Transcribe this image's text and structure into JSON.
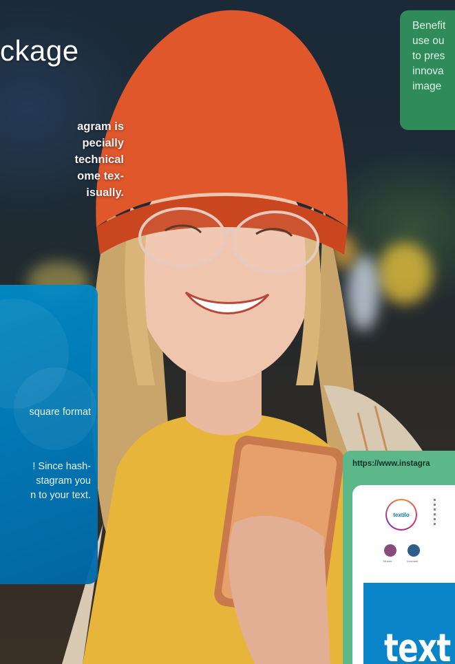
{
  "page": {
    "title": "ckage",
    "intro_lines": [
      "agram is",
      "pecially",
      "technical",
      "ome tex-",
      "isually."
    ]
  },
  "blue_card": {
    "text_1": "square format",
    "text_2_lines": [
      "! Since hash-",
      "stagram you",
      "n to your text."
    ]
  },
  "green_card": {
    "lines": [
      "Benefit",
      "use ou",
      "to pres",
      "innova",
      "image"
    ]
  },
  "instagram_preview": {
    "url": "https://www.instagra",
    "avatar_text": "textilo",
    "highlights": [
      "Muster",
      "Vorrmant"
    ],
    "post_text": "text"
  },
  "colors": {
    "blue_card": "#0a84c8",
    "green_card": "#2f8b5a",
    "insta_panel": "#5cb78a",
    "beanie": "#e0572c",
    "shirt": "#e6b53a"
  }
}
